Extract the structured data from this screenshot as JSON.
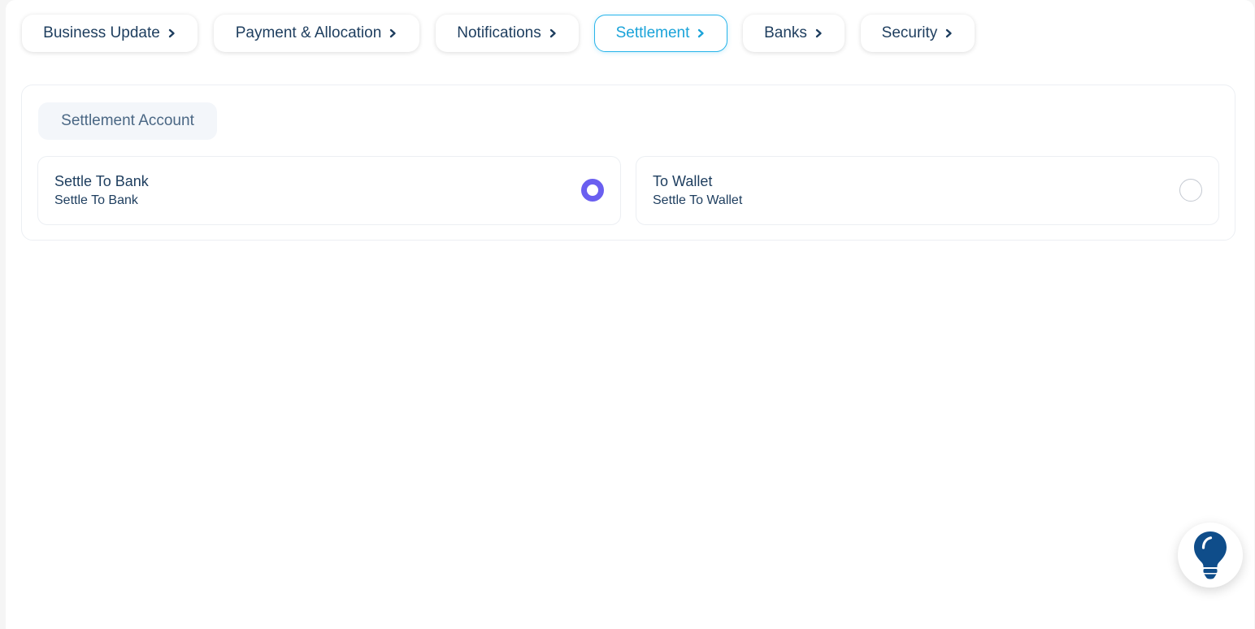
{
  "tabs": [
    {
      "label": "Business Update",
      "active": false
    },
    {
      "label": "Payment & Allocation",
      "active": false
    },
    {
      "label": "Notifications",
      "active": false
    },
    {
      "label": "Settlement",
      "active": true
    },
    {
      "label": "Banks",
      "active": false
    },
    {
      "label": "Security",
      "active": false
    }
  ],
  "settlement": {
    "section_title": "Settlement Account",
    "options": [
      {
        "title": "Settle To Bank",
        "subtitle": "Settle To Bank",
        "selected": true
      },
      {
        "title": "To Wallet",
        "subtitle": "Settle To Wallet",
        "selected": false
      }
    ]
  },
  "icons": {
    "tab_chevron": "chevron-right-icon",
    "help": "lightbulb-icon"
  },
  "colors": {
    "text_primary": "#1d3d5e",
    "active_tab": "#1aa3d9",
    "radio_selected": "#6a5ff0",
    "lightbulb": "#0f4d8a"
  }
}
